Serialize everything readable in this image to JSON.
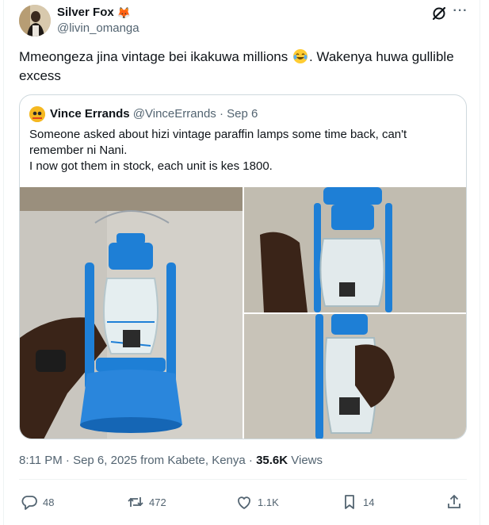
{
  "post": {
    "author": {
      "display_name": "Silver Fox",
      "name_emoji": "🦊",
      "handle": "@livin_omanga"
    },
    "text_before": "Mmeongeza jina vintage bei ikakuwa millions ",
    "text_after": ". Wakenya huwa gullible excess",
    "quote": {
      "author": {
        "display_name": "Vince Errands",
        "handle": "@VinceErrands",
        "separator": " · ",
        "date": "Sep 6"
      },
      "lines": [
        "Someone asked about hizi vintage paraffin lamps some time back, can't",
        "remember ni Nani.",
        "I now got them in stock, each unit is kes 1800."
      ]
    },
    "timestamp": "8:11 PM · Sep 6, 2025 from Kabete, Kenya · ",
    "views_count": "35.6K",
    "views_label": " Views",
    "actions": {
      "replies": "48",
      "retweets": "472",
      "likes": "1.1K",
      "bookmarks": "14"
    }
  },
  "icons": {
    "grok": "grok-icon",
    "more": "more-icon",
    "reply": "reply-icon",
    "retweet": "retweet-icon",
    "like": "heart-icon",
    "bookmark": "bookmark-icon",
    "share": "share-icon",
    "laugh": "laughing-tears-emoji"
  },
  "colors": {
    "text": "#0f1419",
    "secondary": "#536471",
    "border": "#cfd9de",
    "lamp_blue": "#1e7fd6"
  }
}
